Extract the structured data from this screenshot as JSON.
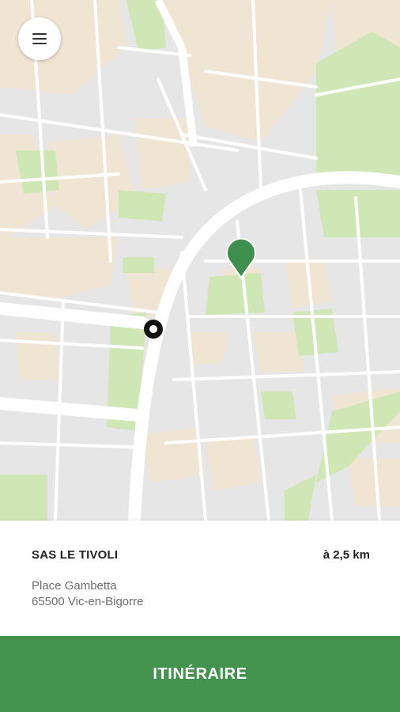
{
  "map": {
    "colors": {
      "background": "#e6e6e6",
      "block": "#f0f0f0",
      "street": "#ffffff",
      "building": "#f0e4d3",
      "park": "#cfe7b4",
      "pin": "#3f8f4f"
    }
  },
  "menu": {
    "icon": "hamburger-menu-icon"
  },
  "place": {
    "name": "SAS LE TIVOLI",
    "distance": "à 2,5 km",
    "address_line1": "Place Gambetta",
    "address_line2": "65500 Vic-en-Bigorre"
  },
  "action": {
    "label": "ITINÉRAIRE",
    "color": "#43924d"
  }
}
